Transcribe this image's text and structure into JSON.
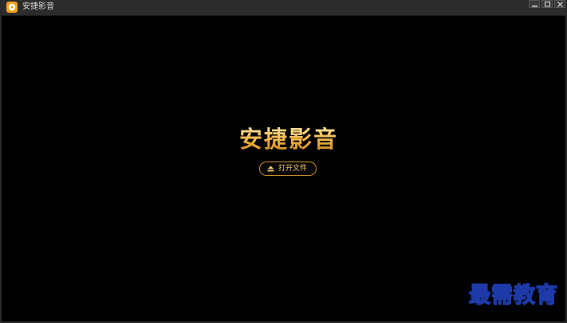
{
  "window": {
    "title": "安捷影音"
  },
  "player": {
    "brand_title": "安捷影音",
    "open_file_label": "打开文件"
  },
  "watermark": {
    "text": "最需教育"
  },
  "icons": {
    "app": "play-logo-icon",
    "open": "eject-icon",
    "minimize": "minimize-icon",
    "maximize": "maximize-icon",
    "close": "close-icon"
  },
  "colors": {
    "accent": "#f0b44a",
    "background": "#000000",
    "titlebar": "#2c2c2c"
  }
}
